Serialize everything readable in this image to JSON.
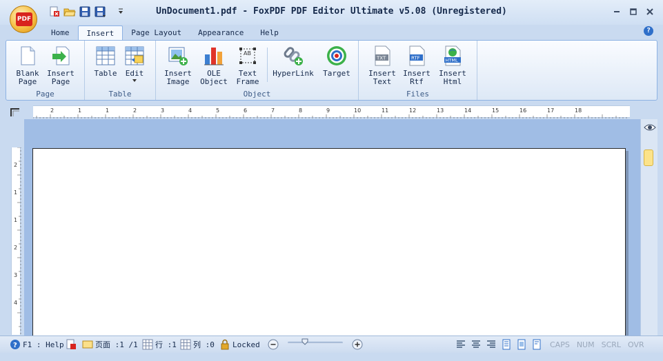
{
  "window": {
    "title": "UnDocument1.pdf - FoxPDF PDF Editor Ultimate v5.08 (Unregistered)"
  },
  "app_logo": {
    "text": "PDF"
  },
  "qat": {
    "icons": [
      "new-pdf-icon",
      "open-folder-icon",
      "save-icon",
      "save-as-icon",
      "customize-qat-icon"
    ]
  },
  "tabs": [
    {
      "label": "Home"
    },
    {
      "label": "Insert"
    },
    {
      "label": "Page Layout"
    },
    {
      "label": "Appearance"
    },
    {
      "label": "Help"
    }
  ],
  "active_tab": "Insert",
  "help_icon": "?",
  "ribbon": {
    "groups": {
      "page": {
        "label": "Page",
        "buttons": [
          {
            "label": "Blank\nPage"
          },
          {
            "label": "Insert\nPage"
          }
        ]
      },
      "table": {
        "label": "Table",
        "buttons": [
          {
            "label": "Table"
          },
          {
            "label": "Edit"
          }
        ]
      },
      "object": {
        "label": "Object",
        "buttons": [
          {
            "label": "Insert\nImage"
          },
          {
            "label": "OLE\nObject"
          },
          {
            "label": "Text\nFrame"
          },
          {
            "label": "HyperLink"
          },
          {
            "label": "Target"
          }
        ]
      },
      "files": {
        "label": "Files",
        "buttons": [
          {
            "label": "Insert\nText",
            "badge": "TXT"
          },
          {
            "label": "Insert\nRtf",
            "badge": "RTF"
          },
          {
            "label": "Insert\nHtml",
            "badge": "HTML"
          }
        ]
      }
    },
    "text_frame_badge": "AB"
  },
  "ruler": {
    "h_labels": [
      "2",
      "1",
      "1",
      "2",
      "3",
      "4",
      "5",
      "6",
      "7",
      "8",
      "9",
      "10",
      "11",
      "12",
      "13",
      "14",
      "15",
      "16",
      "17",
      "18"
    ],
    "v_labels": [
      "2",
      "1",
      "1",
      "2",
      "3",
      "4"
    ]
  },
  "statusbar": {
    "help": "F1 : Help",
    "page_label": "页面 :1 /1",
    "row_label": "行 :1",
    "col_label": "列 :0",
    "locked": "Locked",
    "indicators": [
      "CAPS",
      "NUM",
      "SCRL",
      "OVR"
    ]
  }
}
